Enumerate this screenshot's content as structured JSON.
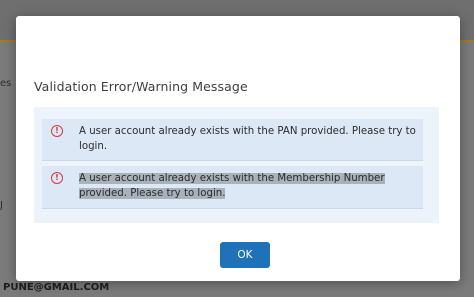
{
  "background": {
    "fragments": [
      "es",
      "J"
    ],
    "email_text": "PUNE@GMAIL.COM"
  },
  "dialog": {
    "title": "Validation Error/Warning Message",
    "messages": [
      {
        "text": "A user account already exists with the PAN provided. Please try to login.",
        "icon": "error-circle-icon"
      },
      {
        "text": "A user account already exists with the Membership Number provided. Please try to login.",
        "icon": "error-circle-icon"
      }
    ],
    "ok_label": "OK"
  },
  "colors": {
    "primary_button": "#1f71b8",
    "error_icon": "#d33a3a",
    "message_bg": "#dde8f6"
  }
}
